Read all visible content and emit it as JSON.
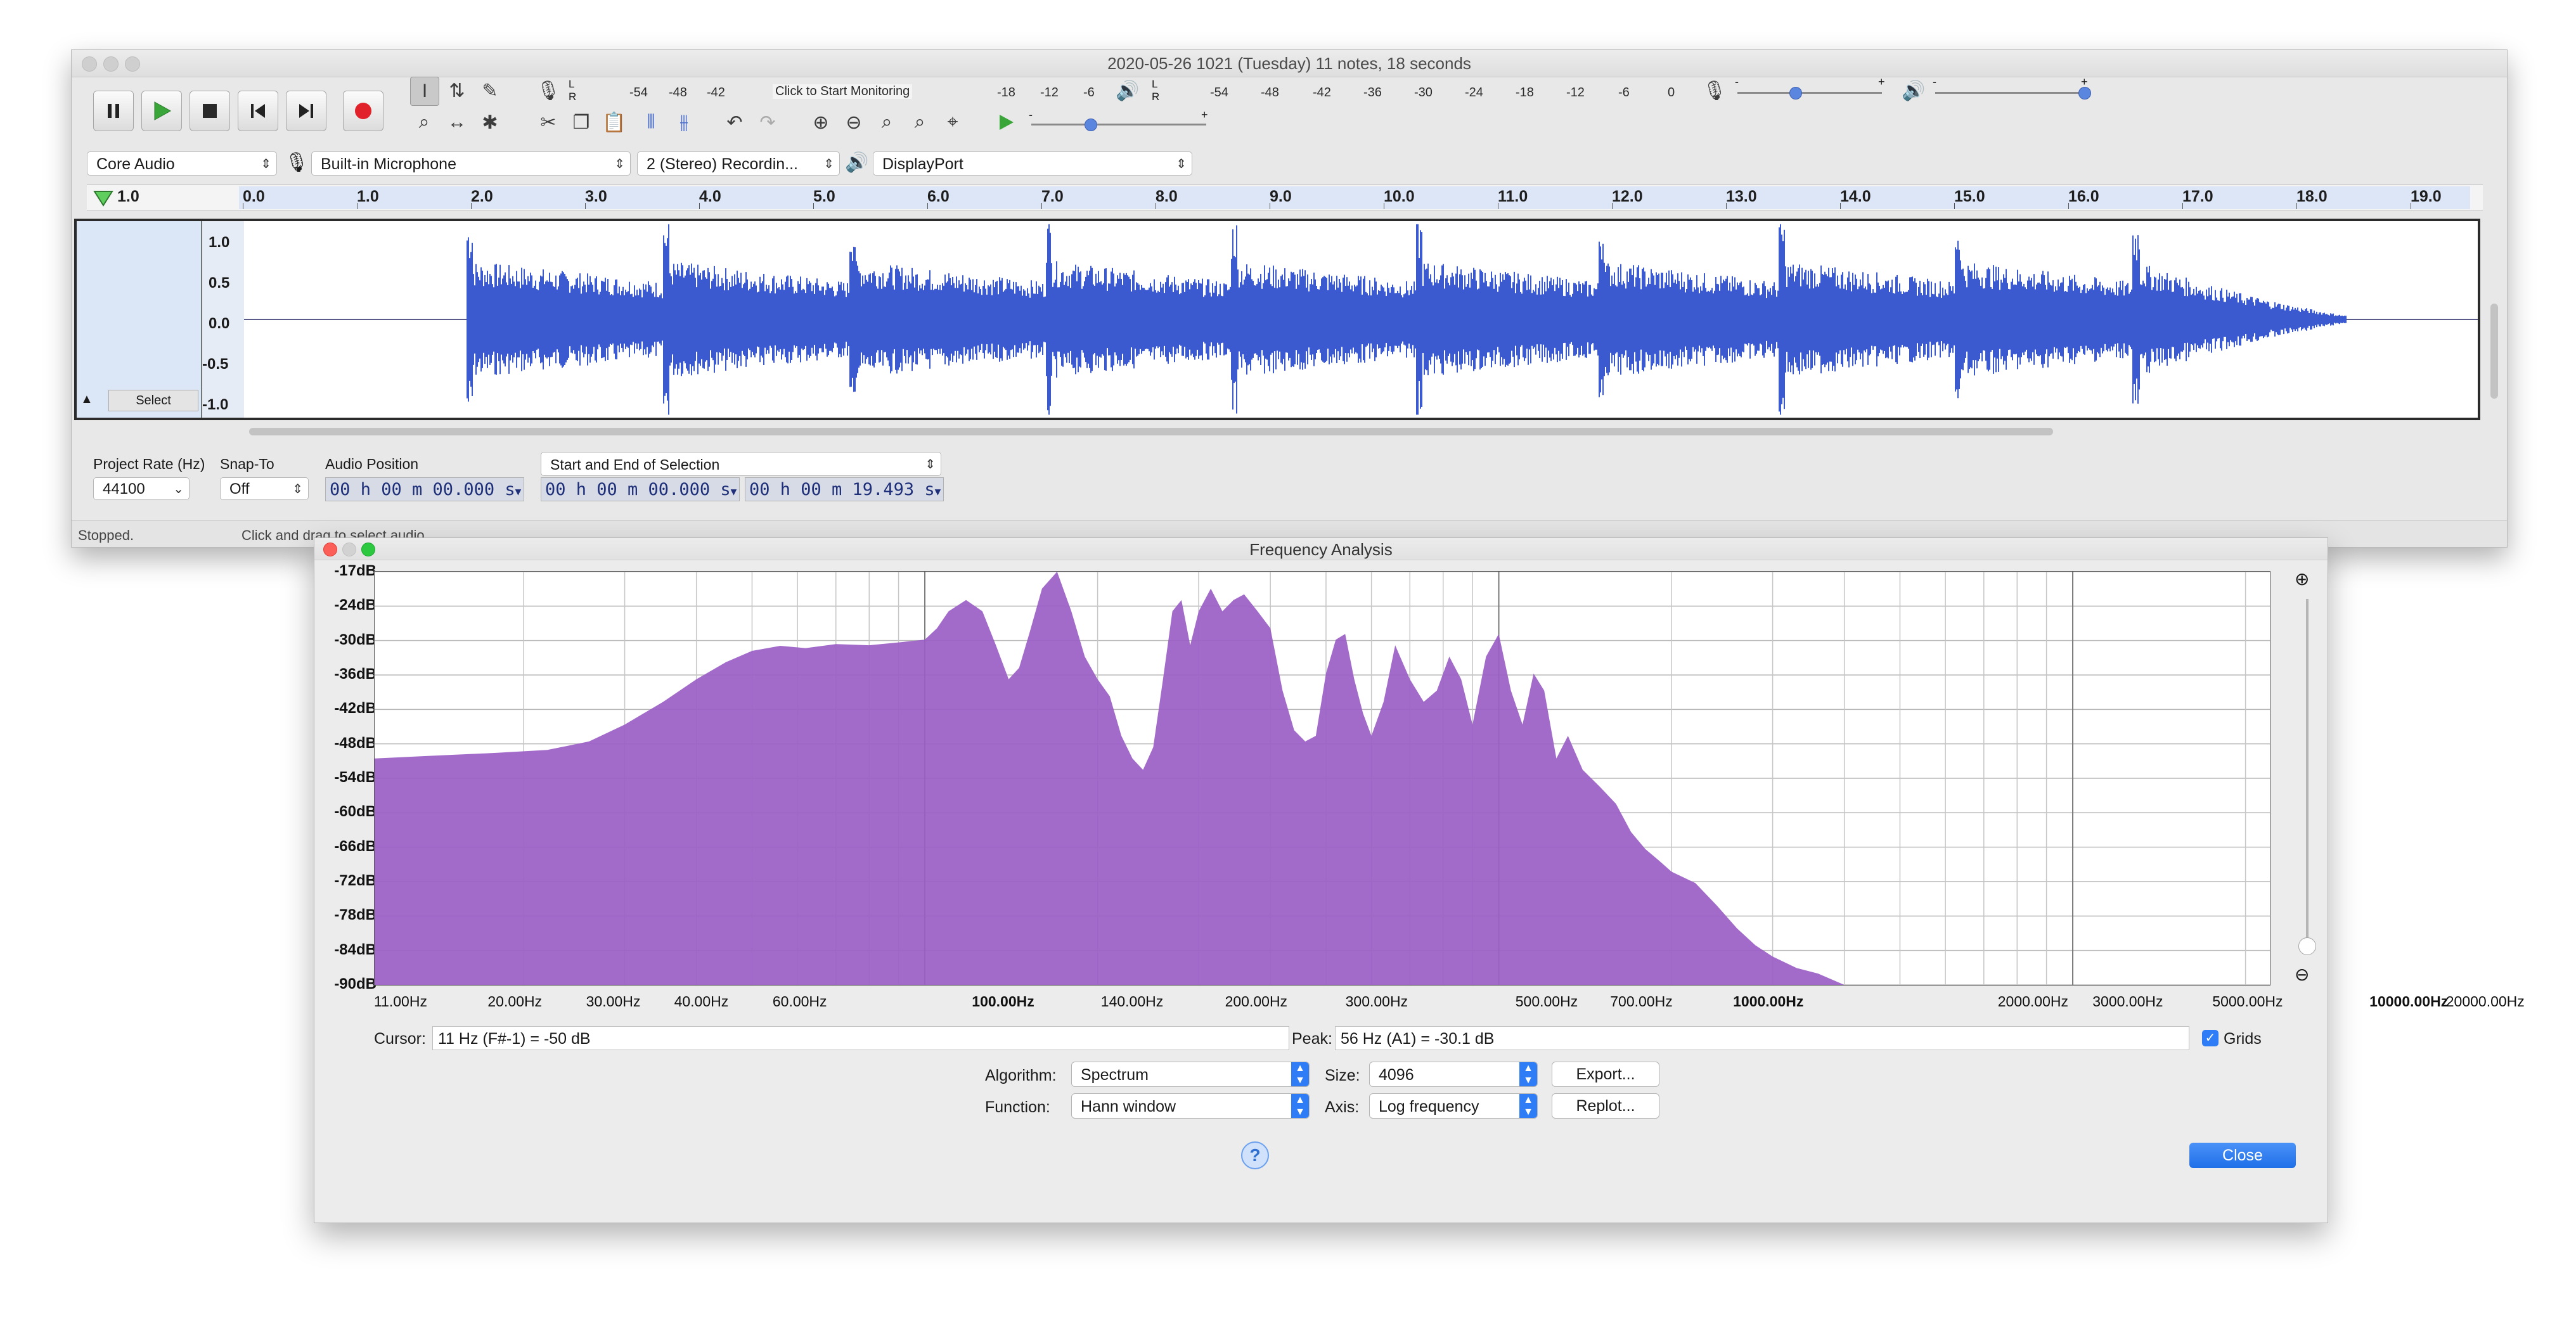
{
  "main_window": {
    "title": "2020-05-26 1021 (Tuesday) 11 notes, 18 seconds",
    "monitor_hint": "Click to Start Monitoring",
    "record_meter_ticks": [
      "-54",
      "-48",
      "-42",
      "-18",
      "-12",
      "-6",
      "0"
    ],
    "playback_meter_ticks": [
      "-54",
      "-48",
      "-42",
      "-36",
      "-30",
      "-24",
      "-18",
      "-12",
      "-6",
      "0"
    ],
    "meter_lr": {
      "l": "L",
      "r": "R"
    },
    "slider_marks": {
      "minus": "-",
      "plus": "+"
    },
    "device": {
      "host": "Core Audio",
      "input": "Built-in Microphone",
      "channels": "2 (Stereo) Recordin...",
      "output": "DisplayPort"
    },
    "ruler": {
      "start": "1.0",
      "labels": [
        "0.0",
        "1.0",
        "2.0",
        "3.0",
        "4.0",
        "5.0",
        "6.0",
        "7.0",
        "8.0",
        "9.0",
        "10.0",
        "11.0",
        "12.0",
        "13.0",
        "14.0",
        "15.0",
        "16.0",
        "17.0",
        "18.0",
        "19.0"
      ]
    },
    "track": {
      "scale_labels": [
        "1.0",
        "0.5",
        "0.0",
        "-0.5",
        "-1.0"
      ],
      "select_label": "Select"
    },
    "selection_bar": {
      "project_rate_label": "Project Rate (Hz)",
      "project_rate": "44100",
      "snap_to_label": "Snap-To",
      "snap_to": "Off",
      "audio_position_label": "Audio Position",
      "audio_position": "00 h 00 m 00.000 s",
      "selection_mode": "Start and End of Selection",
      "selection_start": "00 h 00 m 00.000 s",
      "selection_end": "00 h 00 m 19.493 s"
    },
    "status": {
      "state": "Stopped.",
      "hint": "Click and drag to select audio"
    }
  },
  "freq_window": {
    "title": "Frequency Analysis",
    "y_labels": [
      "-17dB",
      "-24dB",
      "-30dB",
      "-36dB",
      "-42dB",
      "-48dB",
      "-54dB",
      "-60dB",
      "-66dB",
      "-72dB",
      "-78dB",
      "-84dB",
      "-90dB"
    ],
    "x_labels": [
      {
        "text": "11.00Hz",
        "bold": false
      },
      {
        "text": "20.00Hz",
        "bold": false
      },
      {
        "text": "30.00Hz",
        "bold": false
      },
      {
        "text": "40.00Hz",
        "bold": false
      },
      {
        "text": "60.00Hz",
        "bold": false
      },
      {
        "text": "100.00Hz",
        "bold": true
      },
      {
        "text": "140.00Hz",
        "bold": false
      },
      {
        "text": "200.00Hz",
        "bold": false
      },
      {
        "text": "300.00Hz",
        "bold": false
      },
      {
        "text": "500.00Hz",
        "bold": false
      },
      {
        "text": "700.00Hz",
        "bold": false
      },
      {
        "text": "1000.00Hz",
        "bold": true
      },
      {
        "text": "2000.00Hz",
        "bold": false
      },
      {
        "text": "3000.00Hz",
        "bold": false
      },
      {
        "text": "5000.00Hz",
        "bold": false
      },
      {
        "text": "10000.00Hz",
        "bold": true
      },
      {
        "text": "20000.00Hz",
        "bold": false
      }
    ],
    "cursor_label": "Cursor:",
    "cursor_value": "11 Hz (F#-1) = -50 dB",
    "peak_label": "Peak:",
    "peak_value": "56 Hz (A1) = -30.1 dB",
    "grids_label": "Grids",
    "grids_checked": true,
    "algorithm_label": "Algorithm:",
    "algorithm": "Spectrum",
    "size_label": "Size:",
    "size": "4096",
    "export_label": "Export...",
    "function_label": "Function:",
    "function": "Hann window",
    "axis_label": "Axis:",
    "axis": "Log frequency",
    "replot_label": "Replot...",
    "help_glyph": "?",
    "close_label": "Close"
  },
  "chart_data": {
    "type": "area",
    "title": "",
    "xlabel": "",
    "ylabel": "",
    "x_scale": "log",
    "x_range_hz": [
      11,
      22050
    ],
    "ylim_db": [
      -90,
      -17
    ],
    "grid": true,
    "color": "#9a5ec6",
    "series": [
      {
        "x_hz": [
          11,
          14,
          18,
          22,
          26,
          30,
          35,
          40,
          45,
          50,
          56,
          62,
          70,
          80,
          90,
          100,
          105,
          110,
          118,
          126,
          133,
          140,
          146,
          152,
          160,
          170,
          180,
          190,
          200,
          210,
          220,
          230,
          240,
          250,
          260,
          270,
          280,
          290,
          300,
          315,
          330,
          345,
          360,
          380,
          400,
          420,
          440,
          460,
          480,
          500,
          520,
          540,
          560,
          580,
          600,
          630,
          660,
          700,
          740,
          780,
          820,
          860,
          900,
          950,
          1000,
          1050,
          1100,
          1150,
          1200,
          1260,
          1320,
          1400,
          1500,
          1600,
          1700,
          1800,
          1900,
          2000,
          2200,
          2400,
          2600,
          2800,
          3000,
          3300,
          3600,
          4000,
          4400,
          4800,
          5200,
          5600,
          6000,
          7000,
          8000
        ],
        "db": [
          -50,
          -49.5,
          -49,
          -48.5,
          -47,
          -44,
          -40,
          -36,
          -33,
          -31,
          -30.1,
          -30.5,
          -29.8,
          -30,
          -29.5,
          -29,
          -27,
          -24,
          -22,
          -24,
          -30,
          -36,
          -34,
          -28,
          -20,
          -17,
          -24,
          -32,
          -36,
          -39,
          -46,
          -50,
          -52,
          -48,
          -36,
          -24,
          -22,
          -30,
          -24,
          -20,
          -24,
          -22,
          -21,
          -24,
          -27,
          -38,
          -45,
          -47,
          -46,
          -35,
          -29,
          -28,
          -36,
          -42,
          -46,
          -40,
          -30,
          -36,
          -40,
          -38,
          -32,
          -36,
          -44,
          -32,
          -28,
          -38,
          -44,
          -35,
          -38,
          -50,
          -46,
          -52,
          -55,
          -58,
          -63,
          -66,
          -68,
          -70,
          -72,
          -76,
          -80,
          -83,
          -85,
          -87,
          -88,
          -90,
          -90,
          -90,
          -90,
          -90,
          -90,
          -90,
          -90
        ]
      }
    ]
  }
}
